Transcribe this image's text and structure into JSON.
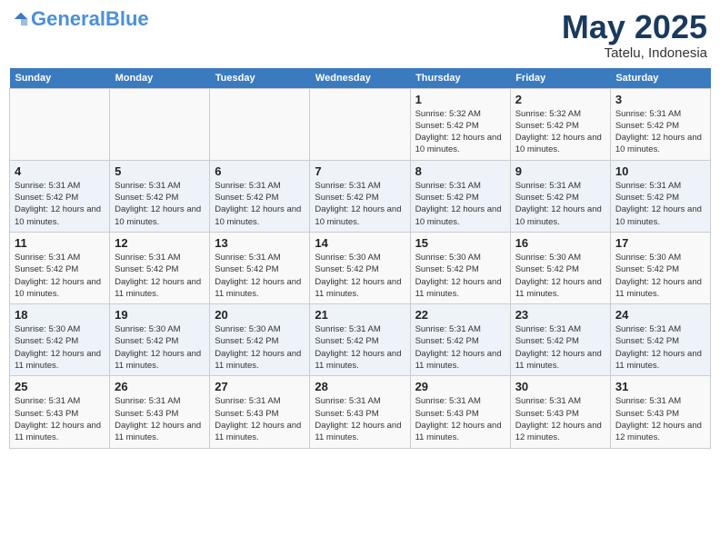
{
  "header": {
    "logo_general": "General",
    "logo_blue": "Blue",
    "title": "May 2025",
    "subtitle": "Tatelu, Indonesia"
  },
  "weekdays": [
    "Sunday",
    "Monday",
    "Tuesday",
    "Wednesday",
    "Thursday",
    "Friday",
    "Saturday"
  ],
  "weeks": [
    [
      {
        "day": "",
        "sunrise": "",
        "sunset": "",
        "daylight": ""
      },
      {
        "day": "",
        "sunrise": "",
        "sunset": "",
        "daylight": ""
      },
      {
        "day": "",
        "sunrise": "",
        "sunset": "",
        "daylight": ""
      },
      {
        "day": "",
        "sunrise": "",
        "sunset": "",
        "daylight": ""
      },
      {
        "day": "1",
        "sunrise": "5:32 AM",
        "sunset": "5:42 PM",
        "daylight": "12 hours and 10 minutes."
      },
      {
        "day": "2",
        "sunrise": "5:32 AM",
        "sunset": "5:42 PM",
        "daylight": "12 hours and 10 minutes."
      },
      {
        "day": "3",
        "sunrise": "5:31 AM",
        "sunset": "5:42 PM",
        "daylight": "12 hours and 10 minutes."
      }
    ],
    [
      {
        "day": "4",
        "sunrise": "5:31 AM",
        "sunset": "5:42 PM",
        "daylight": "12 hours and 10 minutes."
      },
      {
        "day": "5",
        "sunrise": "5:31 AM",
        "sunset": "5:42 PM",
        "daylight": "12 hours and 10 minutes."
      },
      {
        "day": "6",
        "sunrise": "5:31 AM",
        "sunset": "5:42 PM",
        "daylight": "12 hours and 10 minutes."
      },
      {
        "day": "7",
        "sunrise": "5:31 AM",
        "sunset": "5:42 PM",
        "daylight": "12 hours and 10 minutes."
      },
      {
        "day": "8",
        "sunrise": "5:31 AM",
        "sunset": "5:42 PM",
        "daylight": "12 hours and 10 minutes."
      },
      {
        "day": "9",
        "sunrise": "5:31 AM",
        "sunset": "5:42 PM",
        "daylight": "12 hours and 10 minutes."
      },
      {
        "day": "10",
        "sunrise": "5:31 AM",
        "sunset": "5:42 PM",
        "daylight": "12 hours and 10 minutes."
      }
    ],
    [
      {
        "day": "11",
        "sunrise": "5:31 AM",
        "sunset": "5:42 PM",
        "daylight": "12 hours and 10 minutes."
      },
      {
        "day": "12",
        "sunrise": "5:31 AM",
        "sunset": "5:42 PM",
        "daylight": "12 hours and 11 minutes."
      },
      {
        "day": "13",
        "sunrise": "5:31 AM",
        "sunset": "5:42 PM",
        "daylight": "12 hours and 11 minutes."
      },
      {
        "day": "14",
        "sunrise": "5:30 AM",
        "sunset": "5:42 PM",
        "daylight": "12 hours and 11 minutes."
      },
      {
        "day": "15",
        "sunrise": "5:30 AM",
        "sunset": "5:42 PM",
        "daylight": "12 hours and 11 minutes."
      },
      {
        "day": "16",
        "sunrise": "5:30 AM",
        "sunset": "5:42 PM",
        "daylight": "12 hours and 11 minutes."
      },
      {
        "day": "17",
        "sunrise": "5:30 AM",
        "sunset": "5:42 PM",
        "daylight": "12 hours and 11 minutes."
      }
    ],
    [
      {
        "day": "18",
        "sunrise": "5:30 AM",
        "sunset": "5:42 PM",
        "daylight": "12 hours and 11 minutes."
      },
      {
        "day": "19",
        "sunrise": "5:30 AM",
        "sunset": "5:42 PM",
        "daylight": "12 hours and 11 minutes."
      },
      {
        "day": "20",
        "sunrise": "5:30 AM",
        "sunset": "5:42 PM",
        "daylight": "12 hours and 11 minutes."
      },
      {
        "day": "21",
        "sunrise": "5:31 AM",
        "sunset": "5:42 PM",
        "daylight": "12 hours and 11 minutes."
      },
      {
        "day": "22",
        "sunrise": "5:31 AM",
        "sunset": "5:42 PM",
        "daylight": "12 hours and 11 minutes."
      },
      {
        "day": "23",
        "sunrise": "5:31 AM",
        "sunset": "5:42 PM",
        "daylight": "12 hours and 11 minutes."
      },
      {
        "day": "24",
        "sunrise": "5:31 AM",
        "sunset": "5:42 PM",
        "daylight": "12 hours and 11 minutes."
      }
    ],
    [
      {
        "day": "25",
        "sunrise": "5:31 AM",
        "sunset": "5:43 PM",
        "daylight": "12 hours and 11 minutes."
      },
      {
        "day": "26",
        "sunrise": "5:31 AM",
        "sunset": "5:43 PM",
        "daylight": "12 hours and 11 minutes."
      },
      {
        "day": "27",
        "sunrise": "5:31 AM",
        "sunset": "5:43 PM",
        "daylight": "12 hours and 11 minutes."
      },
      {
        "day": "28",
        "sunrise": "5:31 AM",
        "sunset": "5:43 PM",
        "daylight": "12 hours and 11 minutes."
      },
      {
        "day": "29",
        "sunrise": "5:31 AM",
        "sunset": "5:43 PM",
        "daylight": "12 hours and 11 minutes."
      },
      {
        "day": "30",
        "sunrise": "5:31 AM",
        "sunset": "5:43 PM",
        "daylight": "12 hours and 12 minutes."
      },
      {
        "day": "31",
        "sunrise": "5:31 AM",
        "sunset": "5:43 PM",
        "daylight": "12 hours and 12 minutes."
      }
    ]
  ],
  "labels": {
    "sunrise": "Sunrise:",
    "sunset": "Sunset:",
    "daylight": "Daylight:"
  }
}
